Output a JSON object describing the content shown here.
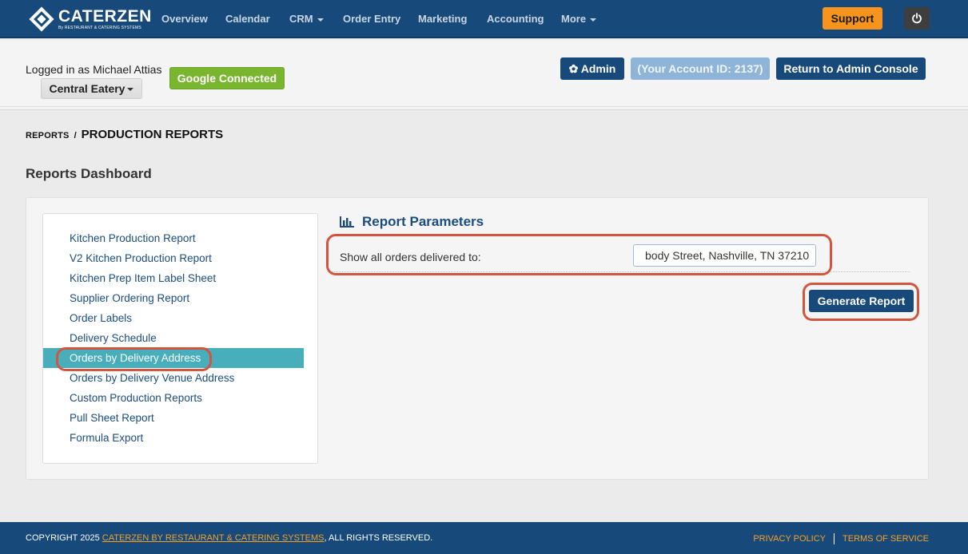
{
  "nav": {
    "logo_text": "CATERZEN",
    "logo_sub": "By RESTAURANT & CATERING SYSTEMS",
    "items": [
      "Overview",
      "Calendar",
      "CRM",
      "Order Entry",
      "Marketing",
      "Accounting",
      "More"
    ],
    "support_label": "Support"
  },
  "account": {
    "logged_in": "Logged in as Michael Attias",
    "store": "Central Eatery",
    "google_label": "Google Connected",
    "admin_label": "Admin",
    "account_id": "(Your Account ID: 2137)",
    "return_label": "Return to Admin Console"
  },
  "breadcrumb": {
    "parent": "REPORTS",
    "separator": "/",
    "current": "PRODUCTION REPORTS"
  },
  "page_title": "Reports Dashboard",
  "menu": {
    "items": [
      "Kitchen Production Report",
      "V2 Kitchen Production Report",
      "Kitchen Prep Item Label Sheet",
      "Supplier Ordering Report",
      "Order Labels",
      "Delivery Schedule",
      "Orders by Delivery Address",
      "Orders by Delivery Venue Address",
      "Custom Production Reports",
      "Pull Sheet Report",
      "Formula Export"
    ],
    "active_index": 6
  },
  "params": {
    "title": "Report Parameters",
    "label": "Show all orders delivered to:",
    "value": "body Street, Nashville, TN 37210",
    "generate_label": "Generate Report"
  },
  "footer": {
    "copy_prefix": "COPYRIGHT 2025",
    "copy_link": "CATERZEN BY RESTAURANT & CATERING SYSTEMS",
    "copy_suffix": ", ALL RIGHTS RESERVED.",
    "privacy": "PRIVACY POLICY",
    "terms": "TERMS OF SERVICE"
  },
  "colors": {
    "navy": "#17497a",
    "orange": "#f7941d",
    "green": "#7ab530",
    "teal_active": "#49aebb",
    "highlight_red": "#d4553f"
  }
}
